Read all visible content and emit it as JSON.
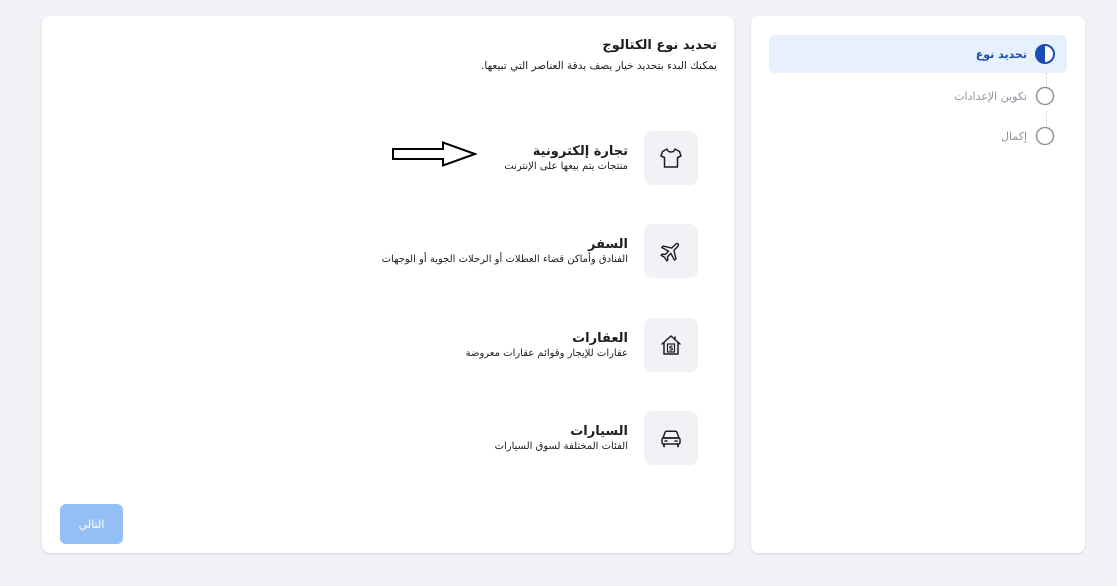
{
  "steps": [
    {
      "label": "تحديد نوع",
      "state": "active",
      "icon": "half-filled-circle-icon"
    },
    {
      "label": "تكوين الإعدادات",
      "state": "pending",
      "icon": "empty-circle-icon"
    },
    {
      "label": "إكمال",
      "state": "pending",
      "icon": "empty-circle-icon"
    }
  ],
  "main": {
    "title": "تحديد نوع الكتالوج",
    "subtitle": "يمكنك البدء بتحديد خيار يصف بدقة العناصر التي تبيعها.",
    "options": [
      {
        "title": "تجارة إلكترونية",
        "description": "منتجات يتم بيعها على الإنترنت",
        "icon": "tshirt-icon"
      },
      {
        "title": "السفر",
        "description": "الفنادق وأماكن قضاء العطلات أو الرحلات الجوية أو الوجهات",
        "icon": "airplane-icon"
      },
      {
        "title": "العقارات",
        "description": "عقارات للإيجار وقوائم عقارات معروضة",
        "icon": "house-dollar-icon"
      },
      {
        "title": "السيارات",
        "description": "الفئات المختلفة لسوق السيارات",
        "icon": "car-icon"
      }
    ],
    "next_label": "التالي"
  },
  "colors": {
    "page_bg": "#f0f2f5",
    "active_step_bg": "#e7f0fd",
    "active_step_text": "#1b4db3",
    "disabled_button_bg": "#94bff5"
  }
}
